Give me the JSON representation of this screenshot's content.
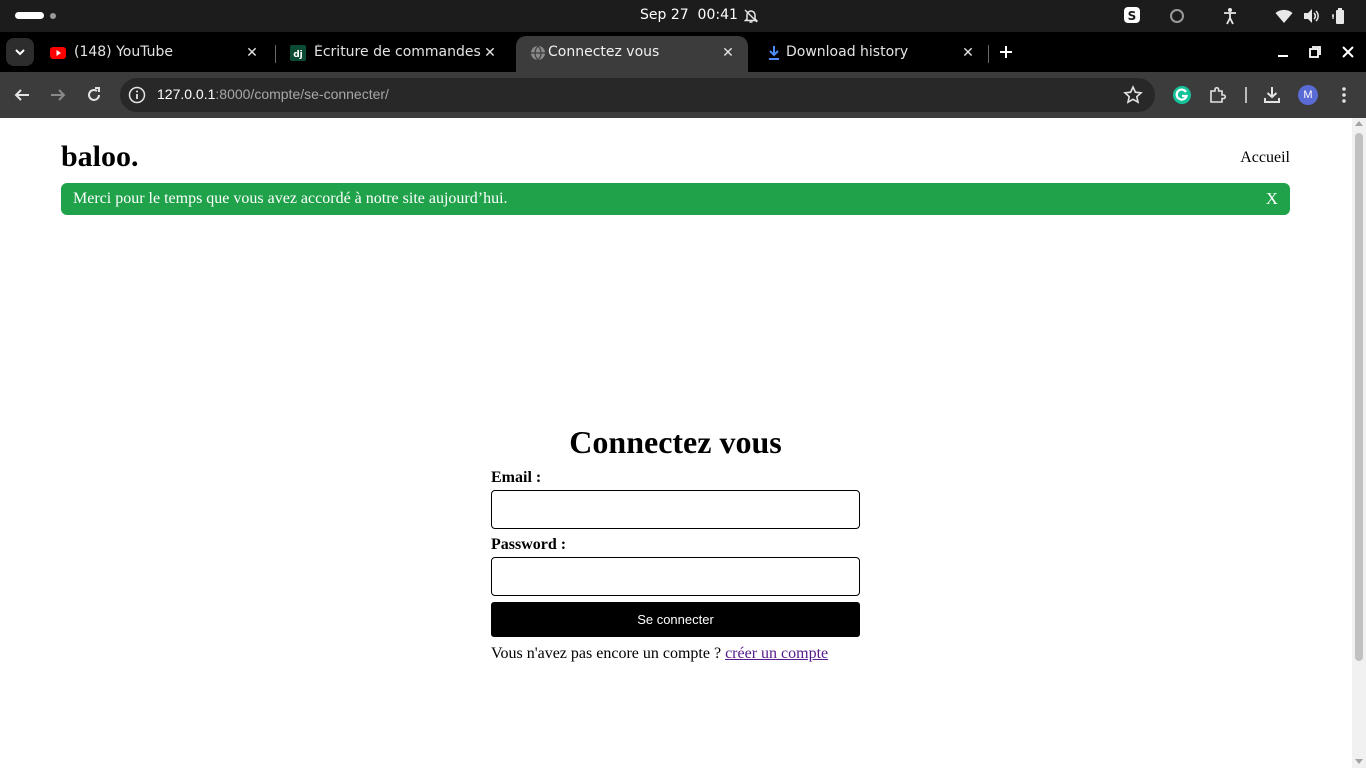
{
  "os": {
    "clock": "Sep 27  00:41"
  },
  "browser": {
    "tabs": [
      {
        "title": "(148) YouTube",
        "icon": "youtube-icon",
        "active": false
      },
      {
        "title": "Écriture de commandes d",
        "icon": "django-icon",
        "active": false
      },
      {
        "title": "Connectez vous",
        "icon": "globe-icon",
        "active": true
      },
      {
        "title": "Download history",
        "icon": "download-icon",
        "active": false
      }
    ],
    "address": {
      "host": "127.0.0.1",
      "path": ":8000/compte/se-connecter/"
    },
    "avatar_initial": "M",
    "colors": {
      "youtube_red": "#ff0000",
      "grammarly_green": "#15c39a",
      "download_blue": "#4c8df6",
      "avatar": "#5b6bd6"
    }
  },
  "page": {
    "brand": "baloo.",
    "nav": {
      "home": "Accueil"
    },
    "alert": {
      "message": "Merci pour le temps que vous avez accordé à notre site aujourd’hui.",
      "close": "X",
      "color": "#1fa24a"
    },
    "login": {
      "title": "Connectez vous",
      "email_label": "Email :",
      "email_value": "",
      "password_label": "Password :",
      "password_value": "",
      "submit": "Se connecter",
      "no_account_text": "Vous n'avez pas encore un compte ?",
      "signup_link": "créer un compte"
    }
  }
}
